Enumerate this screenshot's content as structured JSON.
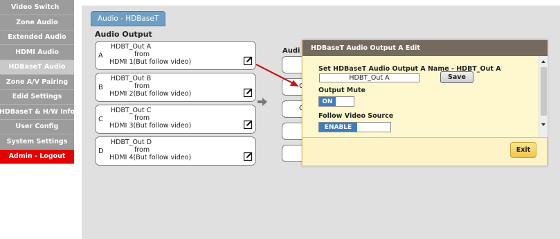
{
  "sidebar": {
    "items": [
      {
        "label": "Video Switch"
      },
      {
        "label": "Zone Audio"
      },
      {
        "label": "Extended Audio"
      },
      {
        "label": "HDMI Audio"
      },
      {
        "label": "HDBaseT Audio"
      },
      {
        "label": "Zone A/V Pairing"
      },
      {
        "label": "Edid Settings"
      },
      {
        "label": "HDBaseT & H/W Info"
      },
      {
        "label": "User Config"
      },
      {
        "label": "System Settings"
      },
      {
        "label": "Admin - Logout"
      }
    ],
    "active_color": "#c9c9c9",
    "logout_color": "#e60000"
  },
  "tab": {
    "label": "Audio - HDBaseT"
  },
  "audio_output": {
    "title": "Audio Output",
    "outputs": [
      {
        "letter": "A",
        "name": "HDBT_Out A",
        "from": "from",
        "source": "HDMI 1(But follow video)"
      },
      {
        "letter": "B",
        "name": "HDBT_Out B",
        "from": "from",
        "source": "HDMI 2(But follow video)"
      },
      {
        "letter": "C",
        "name": "HDBT_Out C",
        "from": "from",
        "source": "HDMI 3(But follow video)"
      },
      {
        "letter": "D",
        "name": "HDBT_Out D",
        "from": "from",
        "source": "HDMI 4(But follow video)"
      }
    ]
  },
  "audio_input": {
    "label": "Audi",
    "box_chars": [
      "",
      "C",
      "C",
      "",
      ""
    ]
  },
  "dialog": {
    "title": "HDBaseT Audio Output A Edit",
    "name_label": "Set HDBaseT Audio Output A Name - HDBT_Out A",
    "name_value": "HDBT_Out A",
    "save_label": "Save",
    "mute_label": "Output Mute",
    "mute_state": "ON",
    "follow_label": "Follow Video Source",
    "follow_state": "ENABLE",
    "exit_label": "Exit"
  },
  "colors": {
    "toggle_blue": "#3a7ec7",
    "dialog_header": "#756a5e",
    "dialog_bg": "#fdf3c6",
    "tab_blue": "#6f9ec4",
    "red_connector": "#c21818"
  }
}
